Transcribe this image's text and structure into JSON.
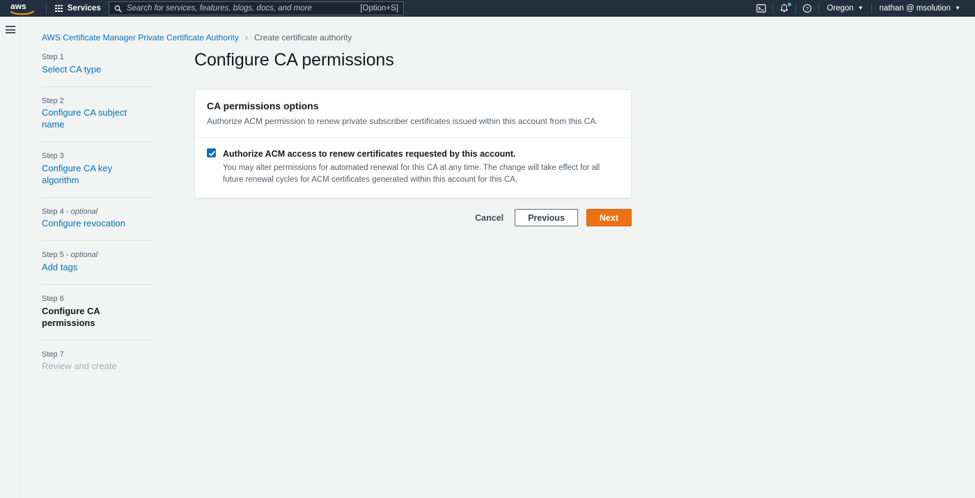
{
  "topnav": {
    "logo_alt": "aws",
    "services_label": "Services",
    "search": {
      "placeholder": "Search for services, features, blogs, docs, and more",
      "shortcut": "[Option+S]",
      "value": ""
    },
    "cloudshell_icon": "cloudshell-icon",
    "notifications_icon": "bell-icon",
    "help_icon": "help-icon",
    "region": "Oregon",
    "account": "nathan @ msolution"
  },
  "rail": {
    "menu_toggle": "hamburger-icon"
  },
  "breadcrumb": {
    "root": "AWS Certificate Manager Private Certificate Authority",
    "separator": "›",
    "current": "Create certificate authority"
  },
  "wizard": {
    "steps": [
      {
        "num": "Step 1",
        "optional": "",
        "title": "Select CA type",
        "state": "link"
      },
      {
        "num": "Step 2",
        "optional": "",
        "title": "Configure CA subject name",
        "state": "link"
      },
      {
        "num": "Step 3",
        "optional": "",
        "title": "Configure CA key algorithm",
        "state": "link"
      },
      {
        "num": "Step 4",
        "optional": " - optional",
        "title": "Configure revocation",
        "state": "link"
      },
      {
        "num": "Step 5",
        "optional": " - optional",
        "title": "Add tags",
        "state": "link"
      },
      {
        "num": "Step 6",
        "optional": "",
        "title": "Configure CA permissions",
        "state": "current"
      },
      {
        "num": "Step 7",
        "optional": "",
        "title": "Review and create",
        "state": "disabled"
      }
    ]
  },
  "main": {
    "title": "Configure CA permissions",
    "card": {
      "heading": "CA permissions options",
      "description": "Authorize ACM permission to renew private subscriber certificates issued within this account from this CA.",
      "checkbox": {
        "checked": true,
        "label": "Authorize ACM access to renew certificates requested by this account.",
        "description": "You may alter permissions for automated renewal for this CA at any time. The change will take effect for all future renewal cycles for ACM certificates generated within this account for this CA."
      }
    },
    "actions": {
      "cancel": "Cancel",
      "previous": "Previous",
      "next": "Next"
    }
  },
  "colors": {
    "nav_background": "#232f3e",
    "page_background": "#f2f3f3",
    "link": "#0073bb",
    "primary_button": "#ec7211",
    "checkbox": "#0a73bb",
    "notification_dot": "#44b9d6"
  }
}
